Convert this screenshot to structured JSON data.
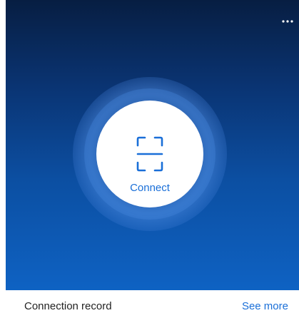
{
  "header": {
    "more_icon": "more-horizontal-icon"
  },
  "connect": {
    "icon": "scan-frame-icon",
    "label": "Connect"
  },
  "records": {
    "title": "Connection record",
    "see_more_label": "See more"
  },
  "colors": {
    "gradient_top": "#071e42",
    "gradient_bottom": "#0e62c3",
    "accent": "#1a6fd8",
    "text": "#222222"
  }
}
